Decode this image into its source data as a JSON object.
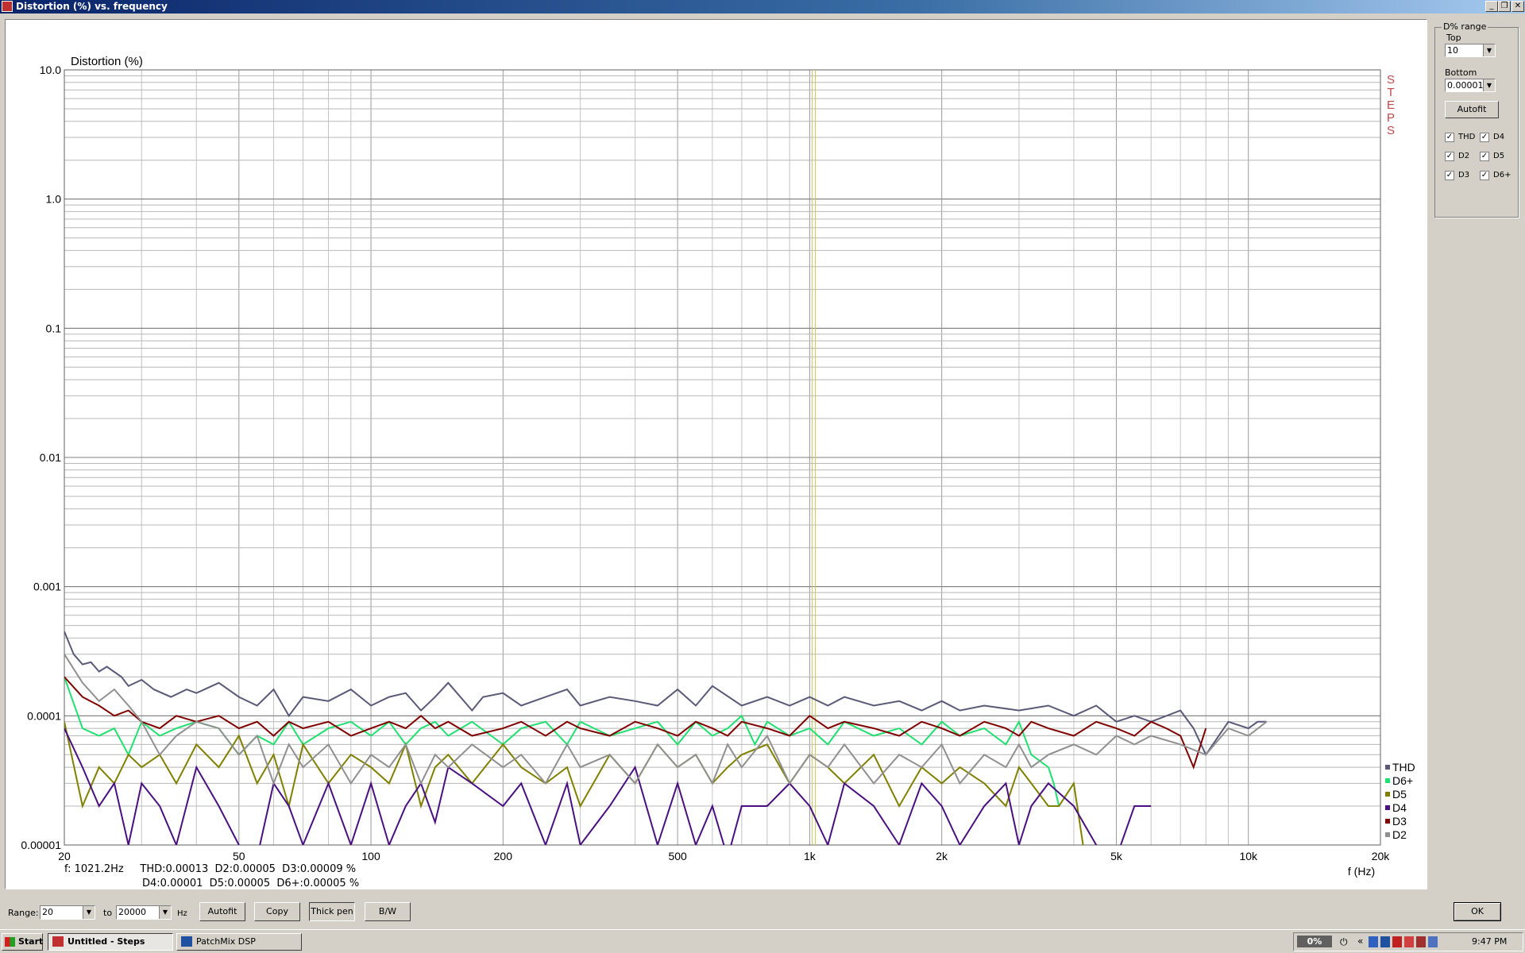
{
  "window": {
    "title": "Distortion (%) vs. frequency",
    "minimize_icon": "_",
    "restore_icon": "❐",
    "close_icon": "✕"
  },
  "chart_data": {
    "type": "line",
    "title": "Distortion (%)",
    "xlabel": "f (Hz)",
    "x_scale": "log",
    "y_scale": "log",
    "xlim": [
      20,
      20000
    ],
    "ylim": [
      1e-05,
      10
    ],
    "x_ticks": [
      {
        "v": 20,
        "label": "20"
      },
      {
        "v": 50,
        "label": "50"
      },
      {
        "v": 100,
        "label": "100"
      },
      {
        "v": 200,
        "label": "200"
      },
      {
        "v": 500,
        "label": "500"
      },
      {
        "v": 1000,
        "label": "1k"
      },
      {
        "v": 2000,
        "label": "2k"
      },
      {
        "v": 5000,
        "label": "5k"
      },
      {
        "v": 10000,
        "label": "10k"
      },
      {
        "v": 20000,
        "label": "20k"
      }
    ],
    "y_ticks": [
      {
        "v": 10,
        "label": "10.0"
      },
      {
        "v": 1,
        "label": "1.0"
      },
      {
        "v": 0.1,
        "label": "0.1"
      },
      {
        "v": 0.01,
        "label": "0.01"
      },
      {
        "v": 0.001,
        "label": "0.001"
      },
      {
        "v": 0.0001,
        "label": "0.0001"
      },
      {
        "v": 1e-05,
        "label": "0.00001"
      }
    ],
    "grid": true,
    "cursor_frequency": 1021.2,
    "side_label": "STEPS",
    "legend_position": "bottom-right",
    "series": [
      {
        "name": "THD",
        "color": "#5a5a78",
        "x": [
          20,
          21,
          22,
          23,
          24,
          25,
          27,
          28,
          30,
          32,
          35,
          38,
          40,
          45,
          50,
          55,
          60,
          65,
          70,
          80,
          90,
          100,
          110,
          120,
          130,
          140,
          150,
          170,
          180,
          200,
          220,
          250,
          280,
          300,
          350,
          400,
          450,
          500,
          550,
          600,
          700,
          800,
          900,
          1000,
          1100,
          1200,
          1400,
          1600,
          1800,
          2000,
          2200,
          2500,
          3000,
          3500,
          4000,
          4500,
          5000,
          5500,
          6000,
          7000,
          7500,
          8000,
          9000,
          10000,
          10500,
          11000
        ],
        "y": [
          0.00045,
          0.0003,
          0.00025,
          0.00026,
          0.00022,
          0.00024,
          0.0002,
          0.00017,
          0.00019,
          0.00016,
          0.00014,
          0.00016,
          0.00015,
          0.00018,
          0.00014,
          0.00012,
          0.00016,
          0.0001,
          0.00014,
          0.00013,
          0.00016,
          0.00012,
          0.00014,
          0.00015,
          0.00011,
          0.00014,
          0.00018,
          0.00011,
          0.00014,
          0.00015,
          0.00012,
          0.00014,
          0.00016,
          0.00012,
          0.00014,
          0.00013,
          0.00012,
          0.00016,
          0.00012,
          0.00017,
          0.00012,
          0.00014,
          0.00012,
          0.00014,
          0.00012,
          0.00014,
          0.00012,
          0.00013,
          0.00011,
          0.00013,
          0.00011,
          0.00012,
          0.00011,
          0.00012,
          0.0001,
          0.00012,
          9e-05,
          0.0001,
          9e-05,
          0.00011,
          8e-05,
          5e-05,
          9e-05,
          8e-05,
          9e-05,
          9e-05
        ]
      },
      {
        "name": "D6+",
        "color": "#20e070",
        "x": [
          20,
          22,
          24,
          26,
          28,
          30,
          33,
          36,
          40,
          45,
          50,
          55,
          60,
          65,
          70,
          80,
          90,
          100,
          110,
          120,
          130,
          140,
          150,
          170,
          200,
          220,
          250,
          280,
          300,
          350,
          400,
          450,
          500,
          550,
          600,
          650,
          700,
          750,
          800,
          900,
          1000,
          1100,
          1200,
          1400,
          1600,
          1800,
          2000,
          2200,
          2500,
          2800,
          3000,
          3200,
          3500,
          3600,
          3700
        ],
        "y": [
          0.0002,
          8e-05,
          7e-05,
          8e-05,
          5e-05,
          9e-05,
          7e-05,
          8e-05,
          9e-05,
          8e-05,
          5e-05,
          7e-05,
          6e-05,
          9e-05,
          6e-05,
          8e-05,
          9e-05,
          7e-05,
          9e-05,
          6e-05,
          8e-05,
          9e-05,
          7e-05,
          9e-05,
          6e-05,
          8e-05,
          9e-05,
          6e-05,
          9e-05,
          7e-05,
          8e-05,
          9e-05,
          6e-05,
          9e-05,
          7e-05,
          8e-05,
          0.0001,
          6e-05,
          9e-05,
          7e-05,
          8e-05,
          6e-05,
          9e-05,
          7e-05,
          8e-05,
          6e-05,
          9e-05,
          7e-05,
          8e-05,
          6e-05,
          9e-05,
          5e-05,
          4e-05,
          3e-05,
          2e-05
        ]
      },
      {
        "name": "D5",
        "color": "#808000",
        "x": [
          20,
          22,
          24,
          26,
          28,
          30,
          33,
          36,
          40,
          45,
          50,
          55,
          60,
          65,
          70,
          80,
          90,
          100,
          110,
          120,
          130,
          140,
          150,
          170,
          200,
          220,
          250,
          280,
          300,
          350,
          400,
          450,
          500,
          550,
          600,
          650,
          700,
          800,
          900,
          1000,
          1100,
          1200,
          1400,
          1600,
          1800,
          2000,
          2200,
          2500,
          2800,
          3000,
          3200,
          3500,
          3700,
          4000,
          4200
        ],
        "y": [
          9e-05,
          2e-05,
          4e-05,
          3e-05,
          5e-05,
          4e-05,
          5e-05,
          3e-05,
          6e-05,
          4e-05,
          7e-05,
          3e-05,
          5e-05,
          2e-05,
          6e-05,
          3e-05,
          5e-05,
          4e-05,
          3e-05,
          6e-05,
          2e-05,
          4e-05,
          5e-05,
          3e-05,
          6e-05,
          4e-05,
          3e-05,
          4e-05,
          2e-05,
          5e-05,
          3e-05,
          6e-05,
          4e-05,
          5e-05,
          3e-05,
          4e-05,
          5e-05,
          6e-05,
          3e-05,
          5e-05,
          4e-05,
          3e-05,
          5e-05,
          2e-05,
          4e-05,
          3e-05,
          4e-05,
          3e-05,
          2e-05,
          4e-05,
          3e-05,
          2e-05,
          2e-05,
          3e-05,
          1e-05
        ]
      },
      {
        "name": "D4",
        "color": "#4a1080",
        "x": [
          20,
          22,
          24,
          26,
          28,
          30,
          33,
          36,
          40,
          45,
          50,
          55,
          60,
          65,
          70,
          80,
          90,
          100,
          110,
          120,
          130,
          140,
          150,
          170,
          200,
          220,
          250,
          280,
          300,
          350,
          400,
          450,
          500,
          550,
          600,
          650,
          700,
          800,
          900,
          1000,
          1100,
          1200,
          1400,
          1600,
          1800,
          2000,
          2200,
          2500,
          2800,
          3000,
          3200,
          3500,
          4000,
          4500,
          5000,
          5500,
          6000
        ],
        "y": [
          8e-05,
          4e-05,
          2e-05,
          3e-05,
          1e-05,
          3e-05,
          2e-05,
          1e-05,
          4e-05,
          2e-05,
          1e-05,
          8e-06,
          3e-05,
          2e-05,
          1e-05,
          3e-05,
          1e-05,
          3e-05,
          1e-05,
          2e-05,
          3e-05,
          1.5e-05,
          4e-05,
          3e-05,
          2e-05,
          3e-05,
          1e-05,
          3e-05,
          1e-05,
          2e-05,
          4e-05,
          1e-05,
          3e-05,
          1e-05,
          2e-05,
          8e-06,
          2e-05,
          2e-05,
          3e-05,
          2e-05,
          1e-05,
          3e-05,
          2e-05,
          1e-05,
          3e-05,
          2e-05,
          1e-05,
          2e-05,
          3e-05,
          1e-05,
          2e-05,
          3e-05,
          2e-05,
          1e-05,
          8e-06,
          2e-05,
          2e-05
        ]
      },
      {
        "name": "D3",
        "color": "#800000",
        "x": [
          20,
          22,
          24,
          26,
          28,
          30,
          33,
          36,
          40,
          45,
          50,
          55,
          60,
          65,
          70,
          80,
          90,
          100,
          110,
          120,
          130,
          140,
          150,
          170,
          200,
          220,
          250,
          280,
          300,
          350,
          400,
          450,
          500,
          550,
          600,
          650,
          700,
          800,
          900,
          1000,
          1100,
          1200,
          1400,
          1600,
          1800,
          2000,
          2200,
          2500,
          2800,
          3000,
          3200,
          3500,
          4000,
          4500,
          5000,
          5500,
          6000,
          6500,
          7000,
          7500,
          8000
        ],
        "y": [
          0.0002,
          0.00014,
          0.00012,
          0.0001,
          0.00011,
          9e-05,
          8e-05,
          0.0001,
          9e-05,
          0.0001,
          8e-05,
          9e-05,
          7e-05,
          9e-05,
          8e-05,
          9e-05,
          7e-05,
          8e-05,
          9e-05,
          8e-05,
          0.0001,
          8e-05,
          9e-05,
          7e-05,
          8e-05,
          9e-05,
          7e-05,
          9e-05,
          8e-05,
          7e-05,
          9e-05,
          8e-05,
          7e-05,
          9e-05,
          8e-05,
          7e-05,
          9e-05,
          8e-05,
          7e-05,
          0.0001,
          8e-05,
          9e-05,
          8e-05,
          7e-05,
          9e-05,
          8e-05,
          7e-05,
          9e-05,
          8e-05,
          7e-05,
          9e-05,
          8e-05,
          7e-05,
          9e-05,
          8e-05,
          7e-05,
          9e-05,
          8e-05,
          7e-05,
          4e-05,
          8e-05
        ]
      },
      {
        "name": "D2",
        "color": "#909090",
        "x": [
          20,
          22,
          24,
          26,
          28,
          30,
          33,
          36,
          40,
          45,
          50,
          55,
          60,
          65,
          70,
          80,
          90,
          100,
          110,
          120,
          130,
          140,
          150,
          170,
          200,
          220,
          250,
          280,
          300,
          350,
          400,
          450,
          500,
          550,
          600,
          650,
          700,
          800,
          900,
          1000,
          1100,
          1200,
          1400,
          1600,
          1800,
          2000,
          2200,
          2500,
          2800,
          3000,
          3200,
          3500,
          4000,
          4500,
          5000,
          5500,
          6000,
          7000,
          8000,
          9000,
          10000,
          11000
        ],
        "y": [
          0.0003,
          0.00018,
          0.00013,
          0.00016,
          0.00012,
          9e-05,
          5e-05,
          7e-05,
          9e-05,
          8e-05,
          5e-05,
          7e-05,
          3e-05,
          6e-05,
          4e-05,
          6e-05,
          3e-05,
          5e-05,
          4e-05,
          6e-05,
          3e-05,
          5e-05,
          4e-05,
          6e-05,
          4e-05,
          5e-05,
          3e-05,
          6e-05,
          4e-05,
          5e-05,
          3e-05,
          6e-05,
          4e-05,
          5e-05,
          3e-05,
          6e-05,
          4e-05,
          7e-05,
          3e-05,
          5e-05,
          4e-05,
          6e-05,
          3e-05,
          5e-05,
          4e-05,
          6e-05,
          3e-05,
          5e-05,
          4e-05,
          6e-05,
          4e-05,
          5e-05,
          6e-05,
          5e-05,
          7e-05,
          6e-05,
          7e-05,
          6e-05,
          5e-05,
          8e-05,
          7e-05,
          9e-05
        ]
      }
    ]
  },
  "readout": {
    "line1": "f: 1021.2Hz     THD:0.00013  D2:0.00005  D3:0.00009 %",
    "line2": "D4:0.00001  D5:0.00005  D6+:0.00005 %"
  },
  "range_group": {
    "title": "D% range",
    "top_label": "Top",
    "top_value": "10",
    "bottom_label": "Bottom",
    "bottom_value": "0.00001",
    "autofit": "Autofit",
    "checks": [
      {
        "label": "THD",
        "checked": true
      },
      {
        "label": "D4",
        "checked": true
      },
      {
        "label": "D2",
        "checked": true
      },
      {
        "label": "D5",
        "checked": true
      },
      {
        "label": "D3",
        "checked": true
      },
      {
        "label": "D6+",
        "checked": true
      }
    ]
  },
  "bottom": {
    "range_label": "Range:",
    "from_value": "20",
    "to_label": "to",
    "to_value": "20000",
    "unit": "Hz",
    "autofit": "Autofit",
    "copy": "Copy",
    "thick_pen": "Thick pen",
    "bw": "B/W",
    "ok": "OK"
  },
  "taskbar": {
    "start": "Start",
    "tasks": [
      "Untitled - Steps",
      "PatchMix DSP"
    ],
    "cpu": "0%",
    "time": "9:47 PM",
    "chevron": "«"
  }
}
